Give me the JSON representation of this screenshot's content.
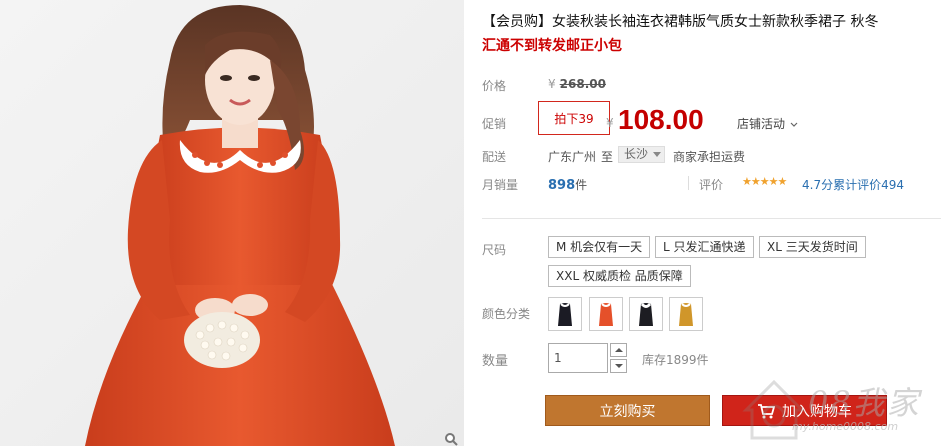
{
  "product": {
    "title": "【会员购】女装秋装长袖连衣裙韩版气质女士新款秋季裙子 秋冬",
    "subtitle": "汇通不到转发邮正小包"
  },
  "price": {
    "label": "价格",
    "currency": "¥",
    "original": "268.00"
  },
  "promo": {
    "label": "促销",
    "tag": "拍下39",
    "currency": "¥",
    "price": "108.00",
    "shop_activity": "店铺活动"
  },
  "shipping": {
    "label": "配送",
    "from": "广东广州",
    "to_word": "至",
    "city": "长沙",
    "fee": "商家承担运费"
  },
  "sales": {
    "label": "月销量",
    "count": "898",
    "unit": "件",
    "review_label": "评价",
    "stars": "★★★★★",
    "rating_text": "4.7分累计评价494"
  },
  "size": {
    "label": "尺码",
    "options": [
      "M 机会仅有一天",
      "L 只发汇通快递",
      "XL 三天发货时间",
      "XXL 权威质检 品质保障"
    ]
  },
  "color": {
    "label": "颜色分类",
    "swatches": [
      {
        "name": "black",
        "hex": "#1b1b24"
      },
      {
        "name": "orange-red",
        "hex": "#e5502a"
      },
      {
        "name": "black-white-collar",
        "hex": "#1d1d22"
      },
      {
        "name": "mustard",
        "hex": "#d0962a"
      }
    ]
  },
  "quantity": {
    "label": "数量",
    "value": "1",
    "stock": "库存1899件"
  },
  "actions": {
    "buy": "立刻购买",
    "cart": "加入购物车"
  },
  "watermark": {
    "text": "08我家",
    "url": "my.home0008.com"
  },
  "colors": {
    "accent_red": "#c40000",
    "buy_button": "#c0762f",
    "cart_button": "#d0241a",
    "dress": "#e0502c"
  }
}
